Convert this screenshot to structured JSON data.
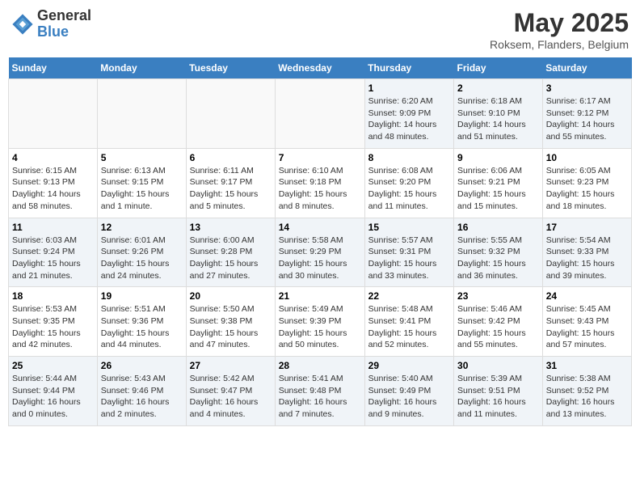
{
  "header": {
    "logo_line1": "General",
    "logo_line2": "Blue",
    "month": "May 2025",
    "location": "Roksem, Flanders, Belgium"
  },
  "weekdays": [
    "Sunday",
    "Monday",
    "Tuesday",
    "Wednesday",
    "Thursday",
    "Friday",
    "Saturday"
  ],
  "weeks": [
    [
      {
        "day": "",
        "info": ""
      },
      {
        "day": "",
        "info": ""
      },
      {
        "day": "",
        "info": ""
      },
      {
        "day": "",
        "info": ""
      },
      {
        "day": "1",
        "info": "Sunrise: 6:20 AM\nSunset: 9:09 PM\nDaylight: 14 hours\nand 48 minutes."
      },
      {
        "day": "2",
        "info": "Sunrise: 6:18 AM\nSunset: 9:10 PM\nDaylight: 14 hours\nand 51 minutes."
      },
      {
        "day": "3",
        "info": "Sunrise: 6:17 AM\nSunset: 9:12 PM\nDaylight: 14 hours\nand 55 minutes."
      }
    ],
    [
      {
        "day": "4",
        "info": "Sunrise: 6:15 AM\nSunset: 9:13 PM\nDaylight: 14 hours\nand 58 minutes."
      },
      {
        "day": "5",
        "info": "Sunrise: 6:13 AM\nSunset: 9:15 PM\nDaylight: 15 hours\nand 1 minute."
      },
      {
        "day": "6",
        "info": "Sunrise: 6:11 AM\nSunset: 9:17 PM\nDaylight: 15 hours\nand 5 minutes."
      },
      {
        "day": "7",
        "info": "Sunrise: 6:10 AM\nSunset: 9:18 PM\nDaylight: 15 hours\nand 8 minutes."
      },
      {
        "day": "8",
        "info": "Sunrise: 6:08 AM\nSunset: 9:20 PM\nDaylight: 15 hours\nand 11 minutes."
      },
      {
        "day": "9",
        "info": "Sunrise: 6:06 AM\nSunset: 9:21 PM\nDaylight: 15 hours\nand 15 minutes."
      },
      {
        "day": "10",
        "info": "Sunrise: 6:05 AM\nSunset: 9:23 PM\nDaylight: 15 hours\nand 18 minutes."
      }
    ],
    [
      {
        "day": "11",
        "info": "Sunrise: 6:03 AM\nSunset: 9:24 PM\nDaylight: 15 hours\nand 21 minutes."
      },
      {
        "day": "12",
        "info": "Sunrise: 6:01 AM\nSunset: 9:26 PM\nDaylight: 15 hours\nand 24 minutes."
      },
      {
        "day": "13",
        "info": "Sunrise: 6:00 AM\nSunset: 9:28 PM\nDaylight: 15 hours\nand 27 minutes."
      },
      {
        "day": "14",
        "info": "Sunrise: 5:58 AM\nSunset: 9:29 PM\nDaylight: 15 hours\nand 30 minutes."
      },
      {
        "day": "15",
        "info": "Sunrise: 5:57 AM\nSunset: 9:31 PM\nDaylight: 15 hours\nand 33 minutes."
      },
      {
        "day": "16",
        "info": "Sunrise: 5:55 AM\nSunset: 9:32 PM\nDaylight: 15 hours\nand 36 minutes."
      },
      {
        "day": "17",
        "info": "Sunrise: 5:54 AM\nSunset: 9:33 PM\nDaylight: 15 hours\nand 39 minutes."
      }
    ],
    [
      {
        "day": "18",
        "info": "Sunrise: 5:53 AM\nSunset: 9:35 PM\nDaylight: 15 hours\nand 42 minutes."
      },
      {
        "day": "19",
        "info": "Sunrise: 5:51 AM\nSunset: 9:36 PM\nDaylight: 15 hours\nand 44 minutes."
      },
      {
        "day": "20",
        "info": "Sunrise: 5:50 AM\nSunset: 9:38 PM\nDaylight: 15 hours\nand 47 minutes."
      },
      {
        "day": "21",
        "info": "Sunrise: 5:49 AM\nSunset: 9:39 PM\nDaylight: 15 hours\nand 50 minutes."
      },
      {
        "day": "22",
        "info": "Sunrise: 5:48 AM\nSunset: 9:41 PM\nDaylight: 15 hours\nand 52 minutes."
      },
      {
        "day": "23",
        "info": "Sunrise: 5:46 AM\nSunset: 9:42 PM\nDaylight: 15 hours\nand 55 minutes."
      },
      {
        "day": "24",
        "info": "Sunrise: 5:45 AM\nSunset: 9:43 PM\nDaylight: 15 hours\nand 57 minutes."
      }
    ],
    [
      {
        "day": "25",
        "info": "Sunrise: 5:44 AM\nSunset: 9:44 PM\nDaylight: 16 hours\nand 0 minutes."
      },
      {
        "day": "26",
        "info": "Sunrise: 5:43 AM\nSunset: 9:46 PM\nDaylight: 16 hours\nand 2 minutes."
      },
      {
        "day": "27",
        "info": "Sunrise: 5:42 AM\nSunset: 9:47 PM\nDaylight: 16 hours\nand 4 minutes."
      },
      {
        "day": "28",
        "info": "Sunrise: 5:41 AM\nSunset: 9:48 PM\nDaylight: 16 hours\nand 7 minutes."
      },
      {
        "day": "29",
        "info": "Sunrise: 5:40 AM\nSunset: 9:49 PM\nDaylight: 16 hours\nand 9 minutes."
      },
      {
        "day": "30",
        "info": "Sunrise: 5:39 AM\nSunset: 9:51 PM\nDaylight: 16 hours\nand 11 minutes."
      },
      {
        "day": "31",
        "info": "Sunrise: 5:38 AM\nSunset: 9:52 PM\nDaylight: 16 hours\nand 13 minutes."
      }
    ]
  ]
}
